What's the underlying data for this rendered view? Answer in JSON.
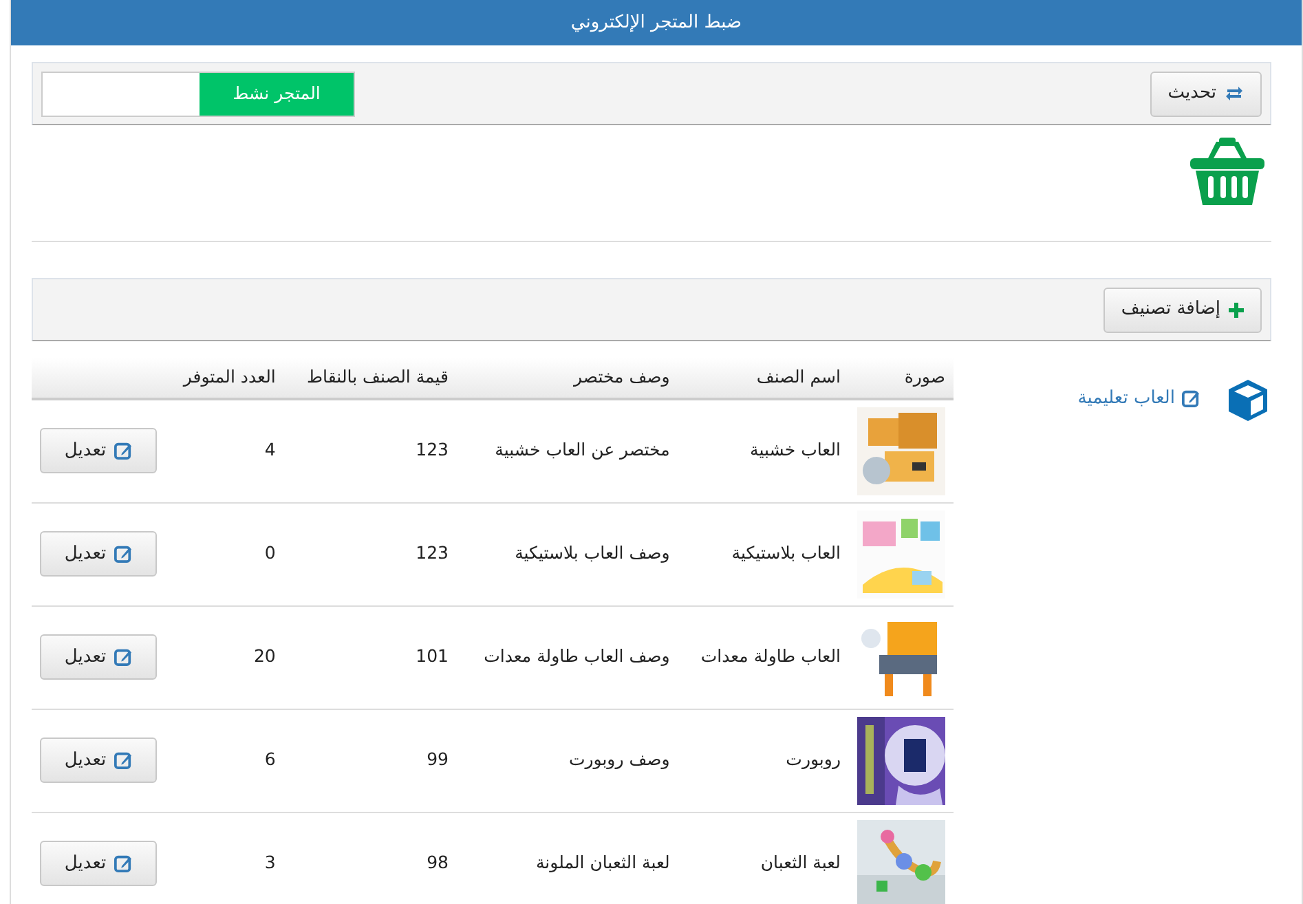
{
  "header": {
    "title": "ضبط المتجر الإلكتروني"
  },
  "toolbar": {
    "refresh_button": "تحديث",
    "store_toggle": {
      "label": "المتجر نشط",
      "on": true
    }
  },
  "categories_toolbar": {
    "add_button": "إضافة تصنيف"
  },
  "sidebar": {
    "items": [
      {
        "label": "العاب تعليمية",
        "selected": true
      }
    ]
  },
  "table": {
    "columns": [
      "صورة",
      "اسم الصنف",
      "وصف مختصر",
      "قيمة الصنف بالنقاط",
      "العدد المتوفر"
    ],
    "rows": [
      {
        "name": "العاب خشبية",
        "description": "مختصر عن العاب خشبية",
        "points": "123",
        "stock": "4",
        "action": "تعديل"
      },
      {
        "name": "العاب بلاستيكية",
        "description": "وصف العاب بلاستيكية",
        "points": "123",
        "stock": "0",
        "action": "تعديل"
      },
      {
        "name": "العاب طاولة معدات",
        "description": "وصف العاب طاولة معدات",
        "points": "101",
        "stock": "20",
        "action": "تعديل"
      },
      {
        "name": "روبورت",
        "description": "وصف روبورت",
        "points": "99",
        "stock": "6",
        "action": "تعديل"
      },
      {
        "name": "لعبة الثعبان",
        "description": "لعبة الثعبان الملونة",
        "points": "98",
        "stock": "3",
        "action": "تعديل"
      }
    ]
  }
}
